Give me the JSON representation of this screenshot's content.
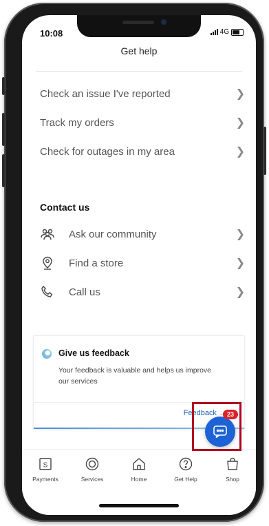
{
  "status": {
    "time": "10:08",
    "network": "4G"
  },
  "header": {
    "title": "Get help"
  },
  "links": [
    {
      "label": "Check an issue I've reported"
    },
    {
      "label": "Track my orders"
    },
    {
      "label": "Check for outages in my area"
    }
  ],
  "contact": {
    "title": "Contact us",
    "items": [
      {
        "label": "Ask our community",
        "icon": "community-icon"
      },
      {
        "label": "Find a store",
        "icon": "location-pin-icon"
      },
      {
        "label": "Call us",
        "icon": "phone-icon"
      }
    ]
  },
  "feedback": {
    "title": "Give us feedback",
    "description": "Your feedback is valuable and helps us improve our services",
    "link": "Feedback →"
  },
  "chat": {
    "badge": "23"
  },
  "tabbar": {
    "items": [
      {
        "label": "Payments",
        "icon": "payments-icon"
      },
      {
        "label": "Services",
        "icon": "services-icon"
      },
      {
        "label": "Home",
        "icon": "home-icon"
      },
      {
        "label": "Get Help",
        "icon": "help-icon"
      },
      {
        "label": "Shop",
        "icon": "shop-bag-icon"
      }
    ]
  },
  "colors": {
    "accent": "#1d63d6",
    "badge": "#d9232a",
    "highlight": "#b00020"
  }
}
